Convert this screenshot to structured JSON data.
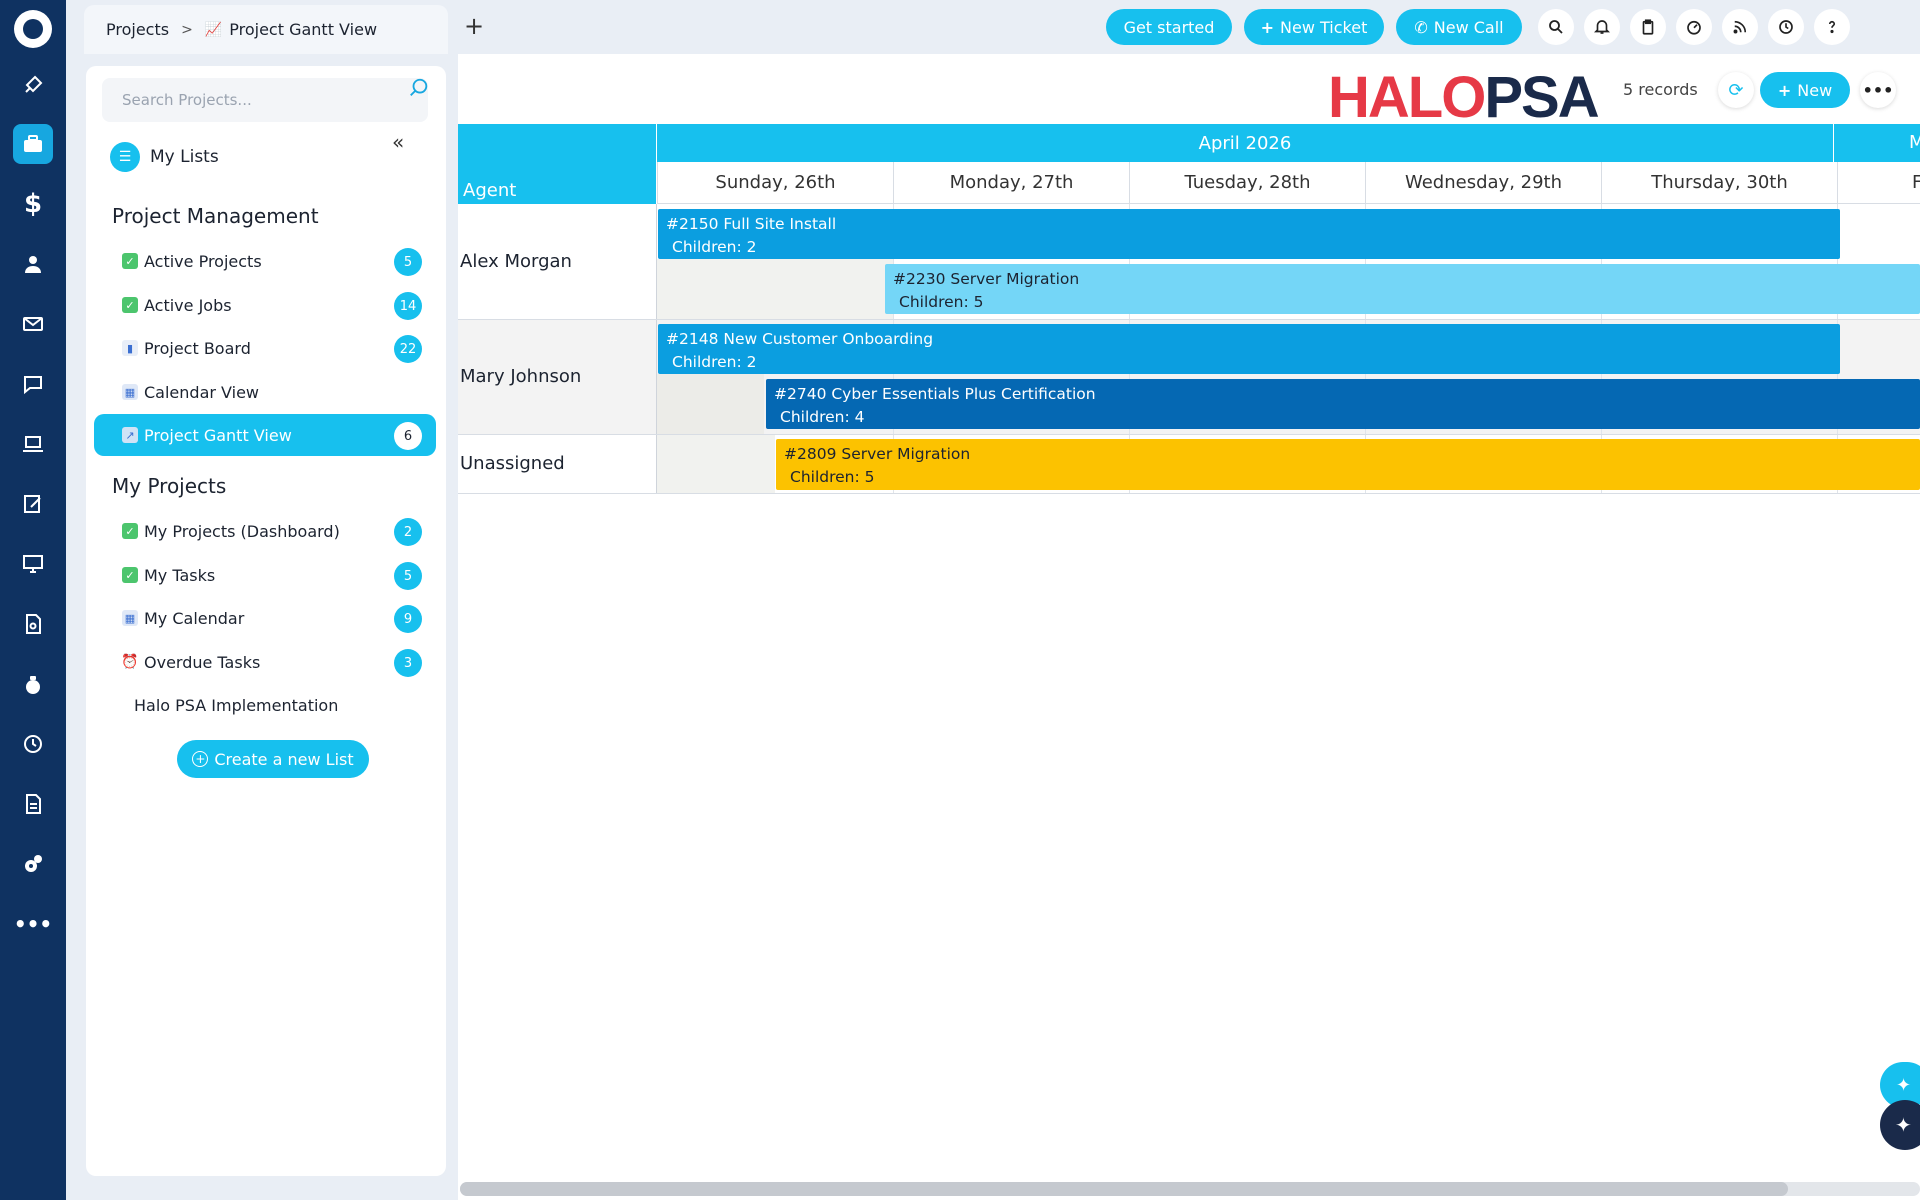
{
  "app": {
    "accent": "#17c0ee",
    "rail_color": "#0f3261"
  },
  "rail": {
    "icons": [
      "logo-icon",
      "rocket-icon",
      "briefcase-icon",
      "dollar-icon",
      "user-icon",
      "envelope-icon",
      "chat-icon",
      "laptop-icon",
      "edit-icon",
      "monitor-icon",
      "document-search-icon",
      "money-bag-icon",
      "clock-icon",
      "file-icon",
      "settings-icon",
      "more-icon"
    ]
  },
  "topbar": {
    "breadcrumb_root": "Projects",
    "breadcrumb_sep": ">",
    "breadcrumb_current": "Project Gantt View",
    "add_tab": "+",
    "get_started": "Get started",
    "new_ticket": "New Ticket",
    "new_call": "New Call"
  },
  "sidebar": {
    "search_placeholder": "Search Projects...",
    "my_lists": "My Lists",
    "collapse": "«",
    "sections": {
      "project_management": "Project Management",
      "my_projects": "My Projects"
    },
    "pm_items": [
      {
        "label": "Active Projects",
        "count": "5",
        "icon": "check-icon"
      },
      {
        "label": "Active Jobs",
        "count": "14",
        "icon": "check-icon"
      },
      {
        "label": "Project Board",
        "count": "22",
        "icon": "bar-chart-icon"
      },
      {
        "label": "Calendar View",
        "count": "",
        "icon": "calendar-icon"
      },
      {
        "label": "Project Gantt View",
        "count": "6",
        "icon": "gantt-icon"
      }
    ],
    "my_items": [
      {
        "label": "My Projects (Dashboard)",
        "count": "2",
        "icon": "check-icon"
      },
      {
        "label": "My Tasks",
        "count": "5",
        "icon": "check-icon"
      },
      {
        "label": "My Calendar",
        "count": "9",
        "icon": "calendar-icon"
      },
      {
        "label": "Overdue Tasks",
        "count": "3",
        "icon": "alarm-icon"
      }
    ],
    "plain_item": "Halo PSA Implementation",
    "create_list": "Create a new List"
  },
  "main": {
    "logo_part1": "HALO",
    "logo_part2": "PSA",
    "records": "5 records",
    "new_label": "New",
    "more": "•••"
  },
  "gantt": {
    "agent_header": "Agent",
    "month": "April 2026",
    "next_month_partial": "M",
    "days": [
      "Sunday, 26th",
      "Monday, 27th",
      "Tuesday, 28th",
      "Wednesday, 29th",
      "Thursday, 30th",
      "Fr"
    ],
    "rows": [
      {
        "agent": "Alex Morgan"
      },
      {
        "agent": "Mary Johnson"
      },
      {
        "agent": "Unassigned"
      }
    ],
    "bars": [
      {
        "title": "#2150 Full Site Install",
        "children": "Children: 2",
        "color": "#0b9ee0"
      },
      {
        "title": "#2230 Server Migration",
        "children": "Children: 5",
        "color": "#74d6f7"
      },
      {
        "title": "#2148 New Customer Onboarding",
        "children": "Children: 2",
        "color": "#0b9ee0"
      },
      {
        "title": "#2740 Cyber Essentials Plus Certification",
        "children": "Children: 4",
        "color": "#0568b3"
      },
      {
        "title": "#2809 Server Migration",
        "children": "Children: 5",
        "color": "#fcc200"
      }
    ]
  }
}
